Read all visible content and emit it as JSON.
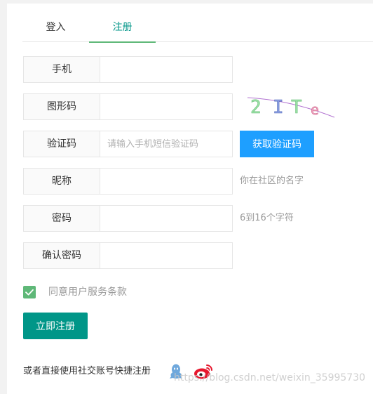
{
  "tabs": [
    {
      "label": "登入",
      "active": false
    },
    {
      "label": "注册",
      "active": true
    }
  ],
  "form": {
    "phone": {
      "label": "手机",
      "value": "",
      "placeholder": ""
    },
    "captcha": {
      "label": "图形码",
      "value": "",
      "placeholder": "",
      "image_text": "2 I T e"
    },
    "sms_code": {
      "label": "验证码",
      "value": "",
      "placeholder": "请输入手机短信验证码",
      "button": "获取验证码"
    },
    "nickname": {
      "label": "昵称",
      "value": "",
      "placeholder": "",
      "hint": "你在社区的名字"
    },
    "password": {
      "label": "密码",
      "value": "",
      "placeholder": "",
      "hint": "6到16个字符"
    },
    "confirm": {
      "label": "确认密码",
      "value": "",
      "placeholder": ""
    }
  },
  "agree": {
    "checked": true,
    "label": "同意用户服务条款"
  },
  "submit": {
    "label": "立即注册"
  },
  "social": {
    "label": "或者直接使用社交账号快捷注册",
    "icons": [
      "qq-icon",
      "weibo-icon"
    ]
  },
  "watermark": "https://blog.csdn.net/weixin_35995730",
  "colors": {
    "primary": "#009688",
    "accent_green": "#5FB878",
    "blue_button": "#1E9FFF",
    "border": "#e6e6e6",
    "label_bg": "#fafafa",
    "hint_text": "#999999"
  }
}
